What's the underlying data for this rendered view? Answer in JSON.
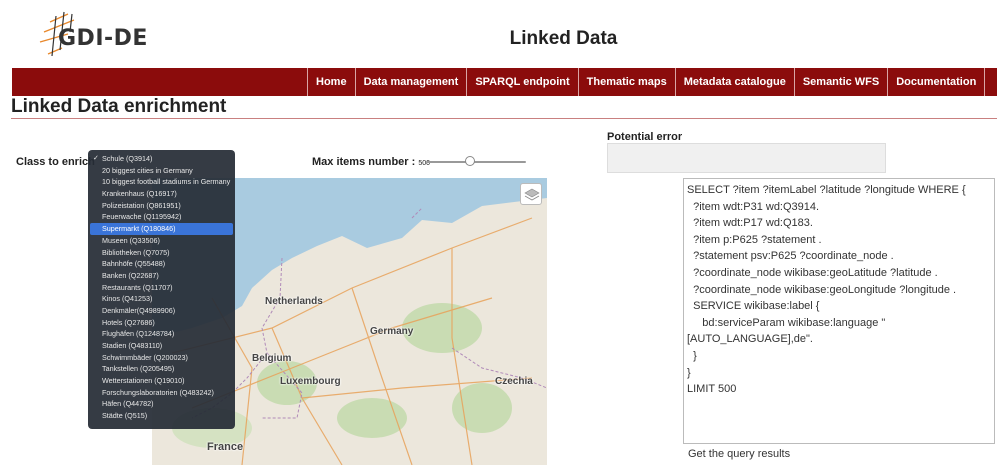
{
  "logo": {
    "text": "GDI-DE"
  },
  "header": {
    "title": "Linked Data"
  },
  "nav": {
    "items": [
      "Home",
      "Data management",
      "SPARQL endpoint",
      "Thematic maps",
      "Metadata catalogue",
      "Semantic WFS",
      "Documentation"
    ]
  },
  "section": {
    "title": "Linked Data enrichment"
  },
  "form": {
    "class_label": "Class to enrich",
    "max_items_label": "Max items number :",
    "max_items_value": "500",
    "max_items_fraction": 0.43
  },
  "error": {
    "label": "Potential error",
    "value": ""
  },
  "dropdown": {
    "selected_index": 0,
    "highlighted_index": 7,
    "options": [
      "Schule (Q3914)",
      "20 biggest cities in Germany",
      "10 biggest football stadiums in Germany",
      "Krankenhaus (Q16917)",
      "Polizeistation (Q861951)",
      "Feuerwache (Q1195942)",
      "Supermarkt (Q180846)",
      "Museen (Q33506)",
      "Bibliotheken (Q7075)",
      "Bahnhöfe (Q55488)",
      "Banken (Q22687)",
      "Restaurants (Q11707)",
      "Kinos (Q41253)",
      "Denkmäler(Q4989906)",
      "Hotels (Q27686)",
      "Flughäfen (Q1248784)",
      "Stadien (Q483110)",
      "Schwimmbäder (Q200023)",
      "Tankstellen (Q205495)",
      "Wetterstationen (Q19010)",
      "Forschungslaboratorien (Q483242)",
      "Häfen (Q44782)",
      "Städte (Q515)"
    ]
  },
  "map": {
    "labels": {
      "netherlands": "Netherlands",
      "germany": "Germany",
      "belgium": "Belgium",
      "luxembourg": "Luxembourg",
      "czechia": "Czechia",
      "france": "France"
    },
    "icons": {
      "layers": "layers-icon"
    },
    "colors": {
      "water": "#a9cbe0",
      "land": "#ece7dc",
      "forest": "#c9dcb3",
      "border": "#b08ab8",
      "road": "#e8a25a"
    }
  },
  "query": {
    "lines": [
      "SELECT ?item ?itemLabel ?latitude ?longitude WHERE {",
      "  ?item wdt:P31 wd:Q3914.",
      "  ?item wdt:P17 wd:Q183.",
      "  ?item p:P625 ?statement .",
      "  ?statement psv:P625 ?coordinate_node .",
      "  ?coordinate_node wikibase:geoLatitude ?latitude .",
      "  ?coordinate_node wikibase:geoLongitude ?longitude .",
      "  SERVICE wikibase:label {",
      "     bd:serviceParam wikibase:language \"",
      "[AUTO_LANGUAGE],de\".",
      "  }",
      "}",
      "LIMIT 500"
    ]
  },
  "actions": {
    "get_results_label": "Get the query results"
  },
  "colors": {
    "navbar": "#8b0c0c",
    "highlight": "#3a74d8",
    "brand_orange": "#e8882c"
  }
}
